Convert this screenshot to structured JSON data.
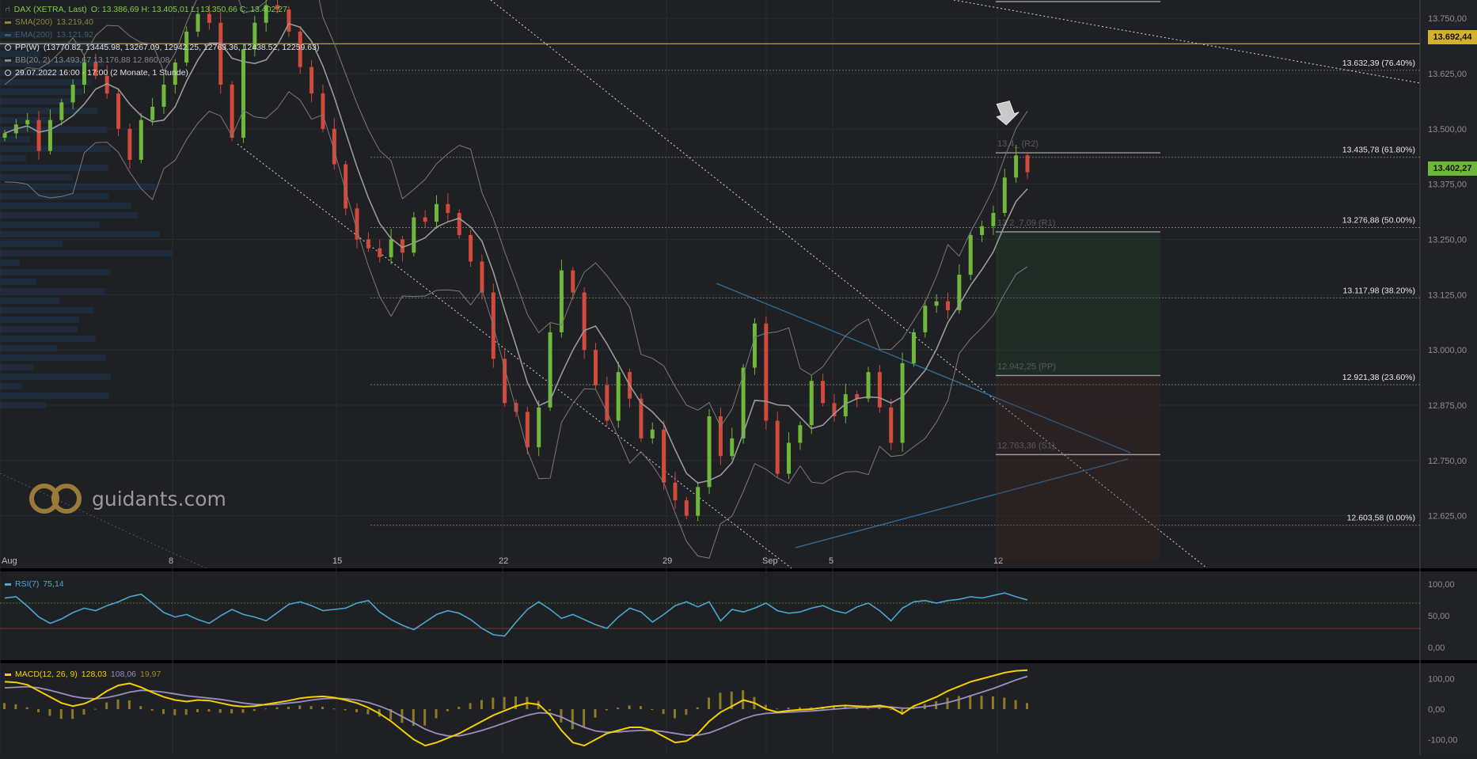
{
  "header": {
    "instrument": "DAX (XETRA, Last)",
    "ohlc": "O: 13.386,69  H: 13.405,01  L: 13.350,66  C: 13.402,27",
    "sma_label": "SMA(200)",
    "sma_value": "13.219,40",
    "ema_label": "EMA(200)",
    "ema_value": "13.121,92",
    "pp_label": "PP(W)",
    "pp_values": "(13770.82, 13445.98, 13267.09, 12942.25, 12763.36, 12438.52, 12259.63)",
    "bb_label": "BB(20, 2)",
    "bb_values": "13.493,67  13.176,88  12.860,08",
    "time_label": "29.07.2022 16:00 - 17:00   (2 Monate, 1 Stunde)"
  },
  "logo": {
    "text": "guidants.com"
  },
  "price_badges": {
    "line": "13.692,44",
    "last": "13.402,27"
  },
  "colors": {
    "up": "#6fb83a",
    "down": "#d24a3c",
    "rsi": "#4aa8d0",
    "macd": "#f5d000",
    "signal": "#9a8fc0",
    "hist": "#a08b2a",
    "line": "#d6b02c"
  },
  "chart_data": [
    {
      "type": "candlestick",
      "title": "DAX (XETRA, Last)",
      "x_ticks": [
        "Aug",
        "8",
        "15",
        "22",
        "29",
        "Sep",
        "5",
        "12"
      ],
      "y_ticks": [
        "13.750,00",
        "13.625,00",
        "13.500,00",
        "13.375,00",
        "13.250,00",
        "13.125,00",
        "13.000,00",
        "12.875,00",
        "12.750,00",
        "12.625,00"
      ],
      "ylim": [
        12560,
        13770
      ],
      "fibonacci": [
        {
          "label": "13.632,39 (76.40%)",
          "value": 13632.39
        },
        {
          "label": "13.435,78 (61.80%)",
          "value": 13435.78
        },
        {
          "label": "13.276,88 (50.00%)",
          "value": 13276.88
        },
        {
          "label": "13.117,98 (38.20%)",
          "value": 13117.98
        },
        {
          "label": "12.921,38 (23.60%)",
          "value": 12921.38
        },
        {
          "label": "12.603,58 (0.00%)",
          "value": 12603.58
        }
      ],
      "pivots": [
        {
          "label": "13.4_ (R2)",
          "value": 13445.98
        },
        {
          "label": "13.2_7,09 (R1)",
          "value": 13267.09
        },
        {
          "label": "12.942,25 (PP)",
          "value": 12942.25
        },
        {
          "label": "12.763,36 (S1)",
          "value": 12763.36
        }
      ],
      "horizontal_line": 13692.44,
      "last": 13402.27,
      "close_path": [
        13490,
        13510,
        13520,
        13450,
        13520,
        13560,
        13600,
        13650,
        13620,
        13580,
        13500,
        13430,
        13520,
        13550,
        13600,
        13650,
        13720,
        13760,
        13740,
        13600,
        13480,
        13680,
        13740,
        13780,
        13770,
        13720,
        13640,
        13580,
        13500,
        13420,
        13320,
        13250,
        13230,
        13210,
        13250,
        13220,
        13300,
        13290,
        13330,
        13310,
        13260,
        13200,
        13130,
        12980,
        12880,
        12860,
        12780,
        12870,
        13040,
        13180,
        13130,
        13000,
        12920,
        12840,
        12950,
        12890,
        12800,
        12820,
        12700,
        12660,
        12625,
        12690,
        12850,
        12760,
        12800,
        12960,
        13060,
        12840,
        12720,
        12790,
        12830,
        12930,
        12880,
        12850,
        12900,
        12890,
        12950,
        12870,
        12790,
        12970,
        13040,
        13100,
        13110,
        13090,
        13170,
        13260,
        13280,
        13310,
        13390,
        13440,
        13402
      ]
    },
    {
      "type": "line",
      "name": "RSI(7)",
      "value_label": "75,14",
      "y_ticks": [
        "100,00",
        "50,00",
        "0,00"
      ],
      "ylim": [
        0,
        100
      ],
      "values": [
        78,
        80,
        65,
        48,
        38,
        45,
        55,
        62,
        58,
        66,
        72,
        80,
        84,
        70,
        55,
        48,
        52,
        44,
        38,
        50,
        60,
        52,
        48,
        42,
        55,
        68,
        72,
        66,
        58,
        60,
        62,
        70,
        74,
        56,
        44,
        35,
        28,
        40,
        52,
        58,
        54,
        44,
        30,
        20,
        18,
        40,
        60,
        72,
        60,
        46,
        52,
        44,
        36,
        30,
        48,
        62,
        56,
        40,
        52,
        66,
        72,
        64,
        72,
        42,
        60,
        56,
        62,
        70,
        58,
        54,
        56,
        62,
        66,
        58,
        54,
        64,
        70,
        58,
        42,
        62,
        72,
        74,
        70,
        74,
        76,
        80,
        78,
        82,
        86,
        80,
        75
      ]
    },
    {
      "type": "bar+line",
      "name": "MACD(12, 26, 9)",
      "value_labels": [
        "128,03",
        "108,06",
        "19,97"
      ],
      "y_ticks": [
        "100,00",
        "0,00",
        "-100,00"
      ],
      "ylim": [
        -125,
        125
      ],
      "macd": [
        90,
        88,
        80,
        60,
        40,
        20,
        10,
        18,
        35,
        60,
        78,
        85,
        72,
        55,
        40,
        30,
        25,
        30,
        28,
        20,
        12,
        8,
        10,
        16,
        22,
        28,
        36,
        40,
        42,
        38,
        30,
        20,
        5,
        -15,
        -40,
        -70,
        -100,
        -120,
        -110,
        -95,
        -80,
        -60,
        -40,
        -20,
        -5,
        10,
        20,
        15,
        -20,
        -70,
        -110,
        -120,
        -100,
        -80,
        -70,
        -60,
        -60,
        -70,
        -90,
        -110,
        -105,
        -80,
        -40,
        -10,
        10,
        30,
        20,
        0,
        -10,
        -5,
        -2,
        0,
        5,
        10,
        12,
        10,
        8,
        12,
        5,
        -15,
        10,
        25,
        40,
        60,
        75,
        90,
        100,
        110,
        120,
        126,
        128
      ],
      "signal": [
        70,
        72,
        74,
        70,
        62,
        52,
        42,
        36,
        34,
        38,
        46,
        56,
        62,
        60,
        56,
        50,
        44,
        40,
        36,
        32,
        26,
        20,
        16,
        14,
        16,
        20,
        24,
        30,
        34,
        36,
        34,
        30,
        22,
        10,
        -5,
        -25,
        -45,
        -66,
        -80,
        -88,
        -88,
        -80,
        -70,
        -58,
        -45,
        -32,
        -20,
        -12,
        -14,
        -26,
        -44,
        -60,
        -72,
        -76,
        -75,
        -72,
        -70,
        -70,
        -74,
        -80,
        -86,
        -86,
        -78,
        -64,
        -48,
        -32,
        -20,
        -14,
        -12,
        -10,
        -8,
        -6,
        -3,
        0,
        3,
        5,
        6,
        7,
        7,
        3,
        4,
        8,
        14,
        22,
        32,
        44,
        56,
        68,
        82,
        96,
        108
      ]
    }
  ]
}
